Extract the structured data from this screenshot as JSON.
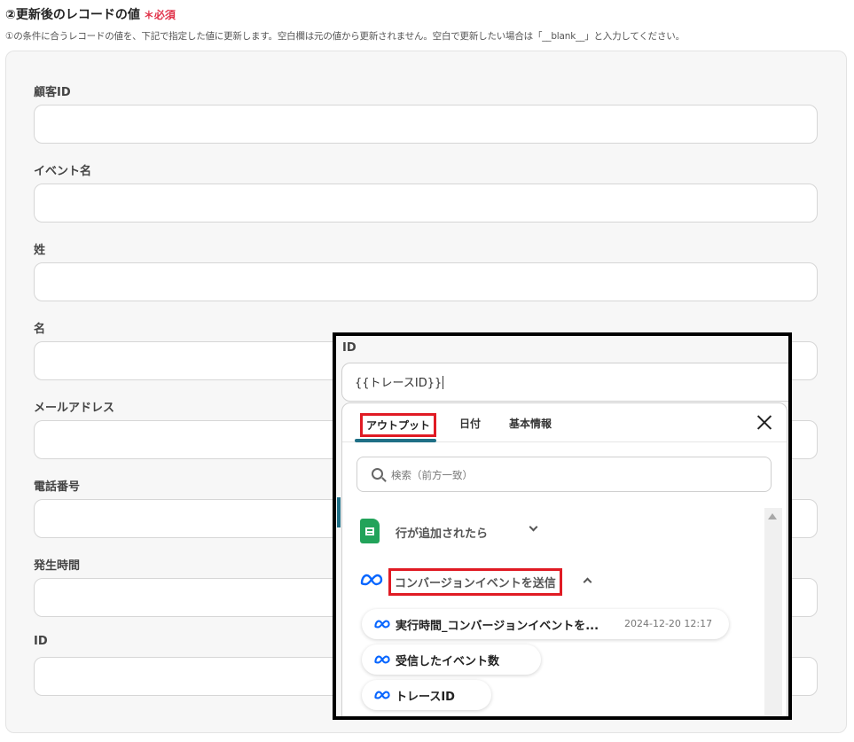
{
  "section": {
    "title": "②更新後のレコードの値",
    "required": "＊必須",
    "description": "①の条件に合うレコードの値を、下記で指定した値に更新します。空白欄は元の値から更新されません。空白で更新したい場合は「__blank__」と入力してください。"
  },
  "fields": [
    {
      "label": "顧客ID"
    },
    {
      "label": "イベント名"
    },
    {
      "label": "姓"
    },
    {
      "label": "名"
    },
    {
      "label": "メールアドレス"
    },
    {
      "label": "電話番号"
    },
    {
      "label": "発生時間"
    },
    {
      "label": "ID"
    }
  ],
  "overlay": {
    "field_label": "ID",
    "field_value": "{{トレースID}}",
    "tabs": [
      "アウトプット",
      "日付",
      "基本情報"
    ],
    "search_placeholder": "検索（前方一致）",
    "groups": [
      {
        "label": "行が追加されたら",
        "icon": "google-sheets-icon",
        "expanded": false
      },
      {
        "label": "コンバージョンイベントを送信",
        "icon": "meta-icon",
        "expanded": true
      }
    ],
    "items": [
      {
        "label": "実行時間_コンバージョンイベントを...",
        "value": "2024-12-20 12:17"
      },
      {
        "label": "受信したイベント数",
        "value": ""
      },
      {
        "label": "トレースID",
        "value": ""
      }
    ]
  },
  "colors": {
    "accent_teal": "#1f6f86",
    "highlight_red": "#e01b24",
    "required_red": "#e0334a",
    "meta_blue": "#0866ff",
    "sheets_green": "#22a35a"
  }
}
